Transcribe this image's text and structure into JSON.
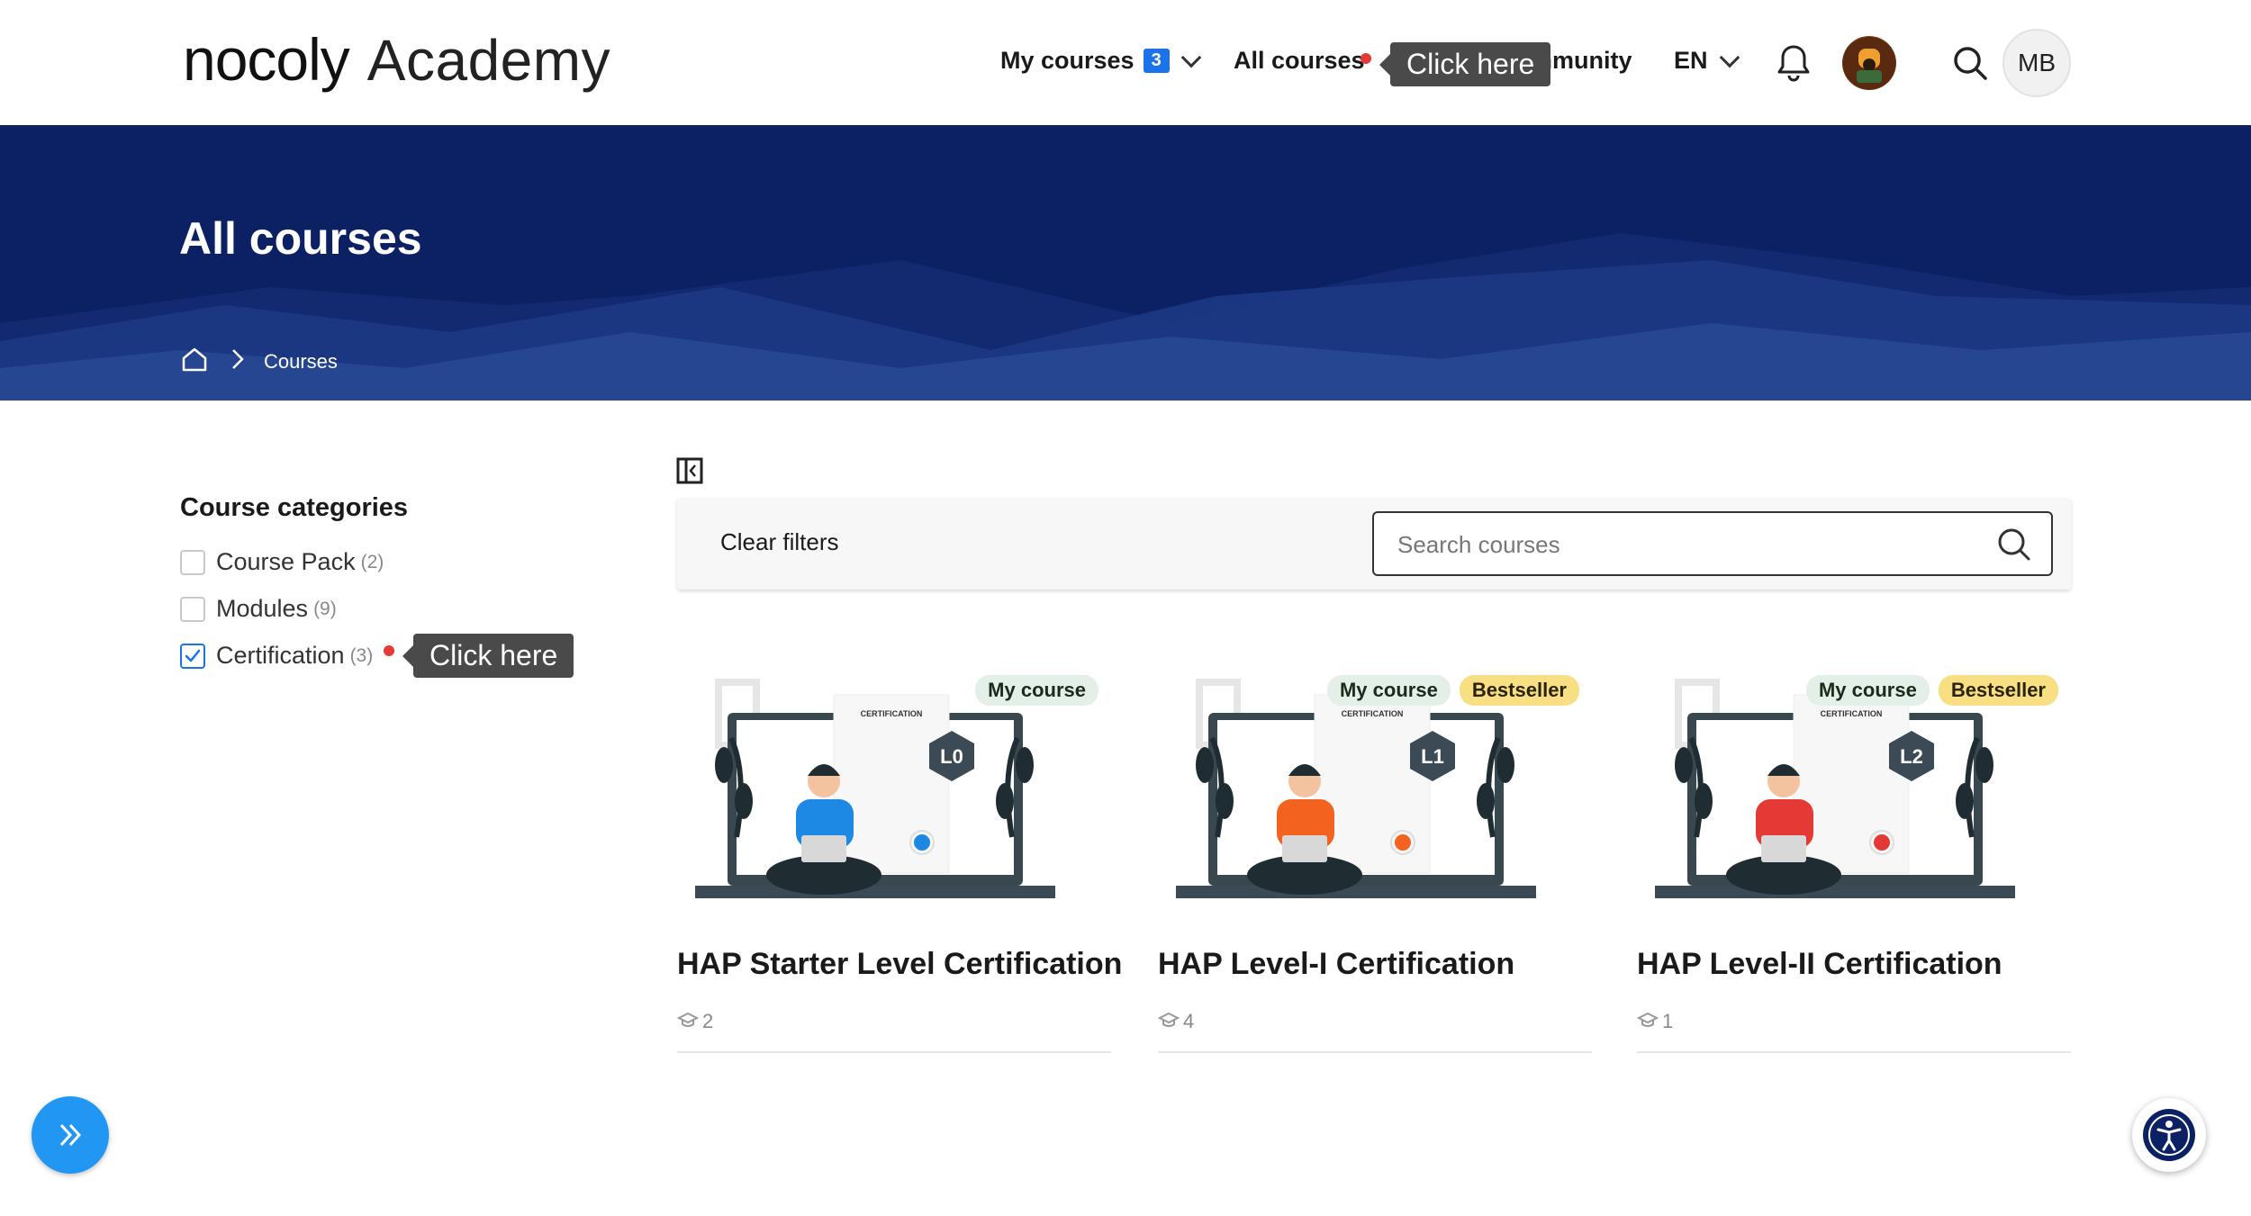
{
  "header": {
    "brand": "nocoly",
    "brand_sub": "Academy",
    "nav": {
      "my_courses": "My courses",
      "my_courses_count": "3",
      "all_courses": "All courses",
      "community": "Community",
      "language": "EN"
    },
    "tooltip": "Click here",
    "user_initials": "MB"
  },
  "banner": {
    "title": "All courses",
    "breadcrumb": "Courses"
  },
  "sidebar": {
    "title": "Course categories",
    "categories": [
      {
        "label": "Course Pack",
        "count": "(2)",
        "checked": false
      },
      {
        "label": "Modules",
        "count": "(9)",
        "checked": false
      },
      {
        "label": "Certification",
        "count": "(3)",
        "checked": true
      }
    ],
    "tooltip": "Click here"
  },
  "filters": {
    "clear_label": "Clear filters",
    "search_placeholder": "Search courses"
  },
  "courses": [
    {
      "title": "HAP Starter Level Certification",
      "level": "L0",
      "cert_label": "CERTIFICATION",
      "tags": [
        "My course"
      ],
      "students": "2",
      "shirt_color": "#1e88e5"
    },
    {
      "title": "HAP Level-I Certification",
      "level": "L1",
      "cert_label": "CERTIFICATION",
      "tags": [
        "My course",
        "Bestseller"
      ],
      "students": "4",
      "shirt_color": "#f4621f"
    },
    {
      "title": "HAP Level-II Certification",
      "level": "L2",
      "cert_label": "CERTIFICATION",
      "tags": [
        "My course",
        "Bestseller"
      ],
      "students": "1",
      "shirt_color": "#e53935"
    }
  ],
  "colors": {
    "banner": "#0b2163",
    "accent": "#1a73e8",
    "bestseller": "#f8df84",
    "my_course": "#e4efe8"
  }
}
